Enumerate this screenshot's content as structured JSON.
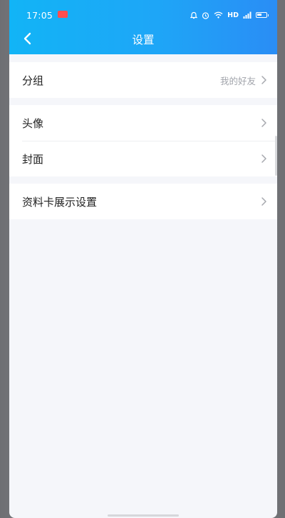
{
  "status_bar": {
    "time": "17:05",
    "network": "HD",
    "notification_badge_color": "#ff4d4f",
    "icons": [
      "alarm-icon",
      "clock-icon",
      "wifi-icon",
      "signal-icon",
      "battery-icon"
    ]
  },
  "header": {
    "title": "设置",
    "back_icon": "chevron-left-icon",
    "gradient_start": "#12b4f6",
    "gradient_end": "#2a8df5"
  },
  "settings": {
    "group_row": {
      "label": "分组",
      "value": "我的好友"
    },
    "avatar_row": {
      "label": "头像"
    },
    "cover_row": {
      "label": "封面"
    },
    "profile_card_row": {
      "label": "资料卡展示设置"
    }
  },
  "colors": {
    "background": "#f5f6fa",
    "row_background": "#ffffff",
    "secondary_text": "#a1a4ab"
  }
}
